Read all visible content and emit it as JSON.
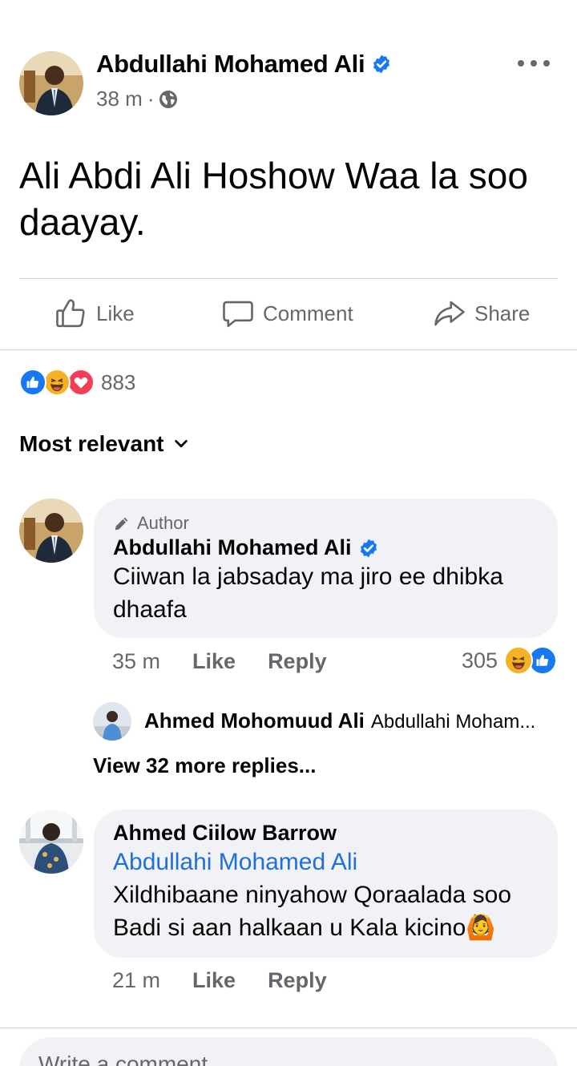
{
  "post": {
    "author": "Abdullahi Mohamed Ali",
    "time": "38 m",
    "separator": "·",
    "privacy_icon": "globe-icon",
    "text": "Ali Abdi Ali Hoshow Waa la soo daayay."
  },
  "actions": {
    "like": "Like",
    "comment": "Comment",
    "share": "Share"
  },
  "reactions": {
    "types": [
      "like",
      "haha",
      "love"
    ],
    "count": "883"
  },
  "sort": {
    "label": "Most relevant"
  },
  "comments": [
    {
      "badge": "Author",
      "name": "Abdullahi Mohamed Ali",
      "text": "Ciiwan la jabsaday ma jiro ee dhibka dhaafa",
      "time": "35 m",
      "like": "Like",
      "reply": "Reply",
      "reaction_count": "305",
      "reaction_types": [
        "haha",
        "like"
      ],
      "latest_reply": {
        "name": "Ahmed Mohomuud Ali",
        "snippet": "Abdullahi Moham..."
      },
      "view_more": "View 32 more replies..."
    },
    {
      "name": "Ahmed Ciilow Barrow",
      "tag": "Abdullahi Mohamed Ali",
      "text": "Xildhibaane ninyahow Qoraalada soo Badi si aan halkaan u Kala kicino",
      "emoji": "🙆",
      "time": "21 m",
      "like": "Like",
      "reply": "Reply"
    }
  ],
  "composer": {
    "placeholder": "Write a comment..."
  },
  "colors": {
    "verified_blue": "#1877f2",
    "link_blue": "#216fdb",
    "love_red": "#f33e58",
    "haha_yellow": "#f7b125",
    "bubble_bg": "#f0f2f5",
    "muted_text": "#65676b"
  }
}
